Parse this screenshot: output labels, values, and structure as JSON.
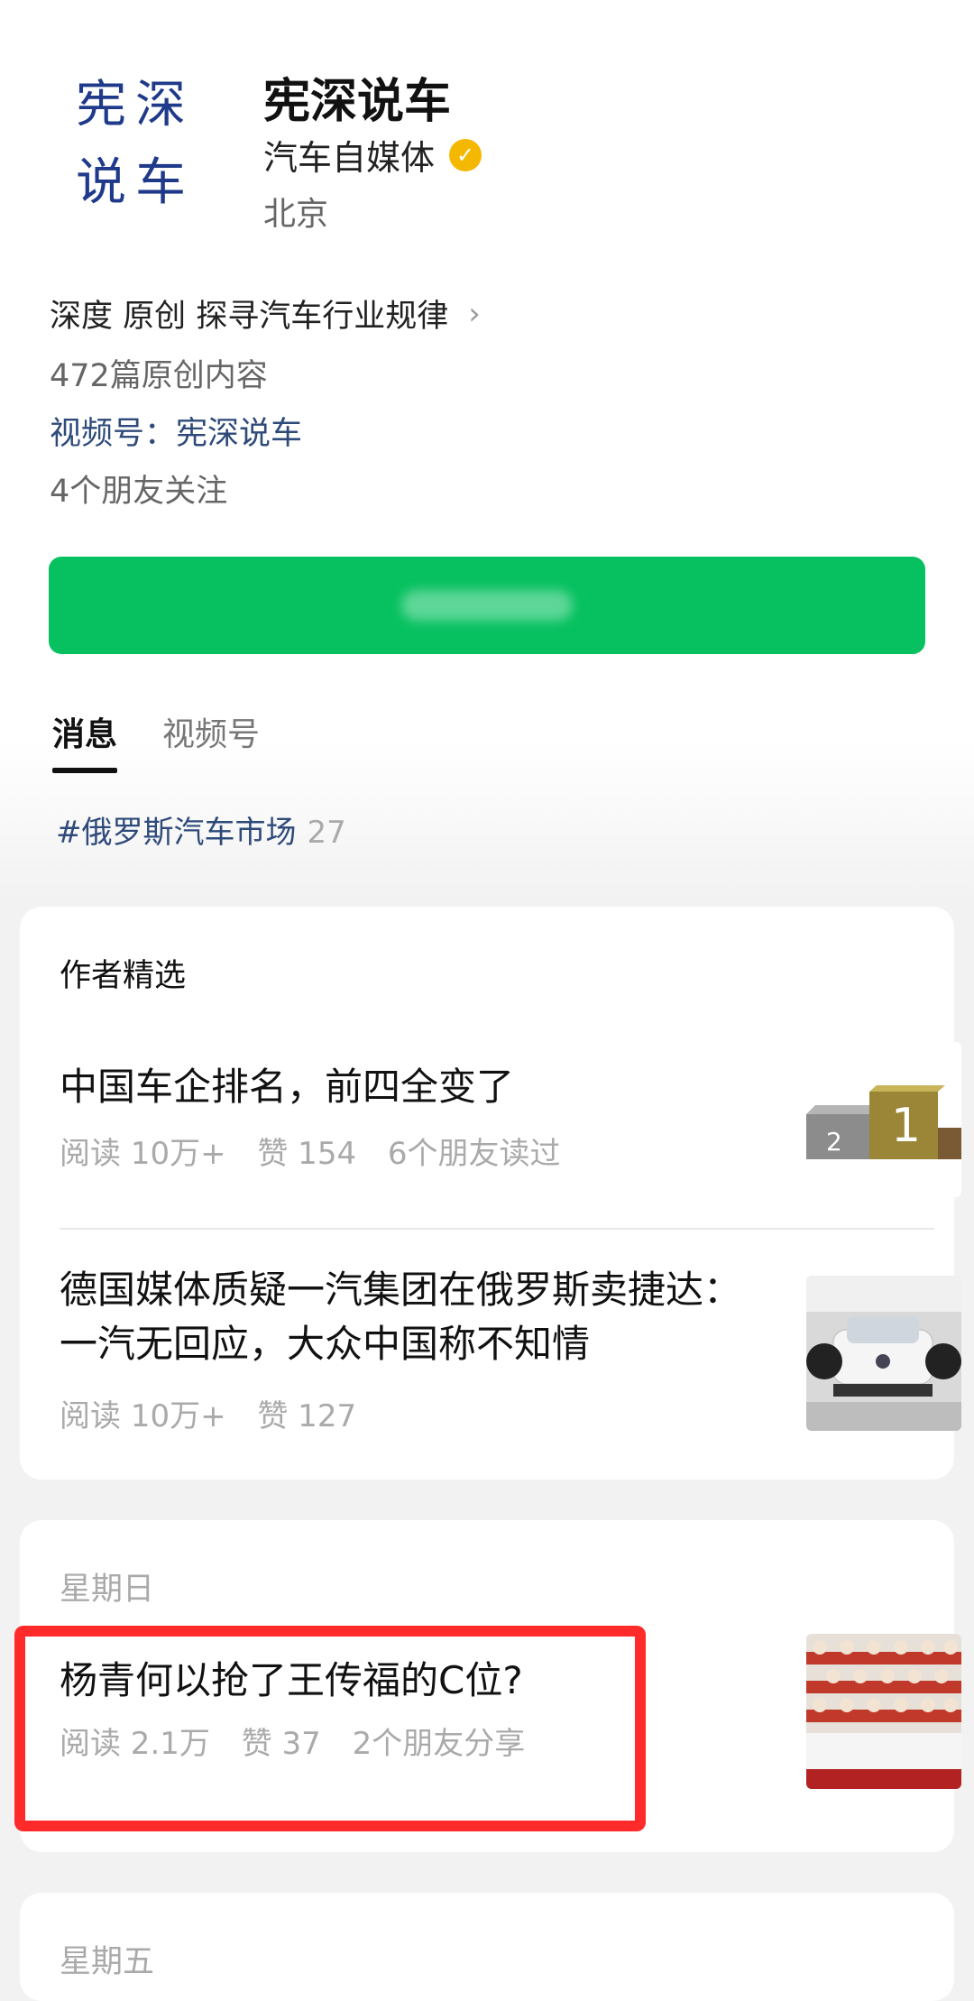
{
  "profile": {
    "avatar_text_line1": "宪深",
    "avatar_text_line2": "说车",
    "name": "宪深说车",
    "type": "汽车自媒体",
    "verified_icon": "verified-badge-icon",
    "location": "北京",
    "description": "深度 原创 探寻汽车行业规律",
    "original_count": "472篇原创内容",
    "channel": "视频号：宪深说车",
    "friends_following": "4个朋友关注",
    "brand_color": "#07c160"
  },
  "tabs": [
    {
      "label": "消息",
      "active": true
    },
    {
      "label": "视频号",
      "active": false
    }
  ],
  "hashtag": {
    "tag": "#俄罗斯汽车市场",
    "count": "27"
  },
  "featured": {
    "title": "作者精选",
    "articles": [
      {
        "title": "中国车企排名，前四全变了",
        "reads": "阅读 10万+",
        "likes": "赞 154",
        "friends": "6个朋友读过"
      },
      {
        "title": "德国媒体质疑一汽集团在俄罗斯卖捷达：一汽无回应，大众中国称不知情",
        "reads": "阅读 10万+",
        "likes": "赞 127"
      }
    ]
  },
  "sunday": {
    "date": "星期日",
    "article": {
      "title": "杨青何以抢了王传福的C位?",
      "reads": "阅读 2.1万",
      "likes": "赞 37",
      "friends": "2个朋友分享"
    }
  },
  "friday": {
    "date": "星期五"
  }
}
